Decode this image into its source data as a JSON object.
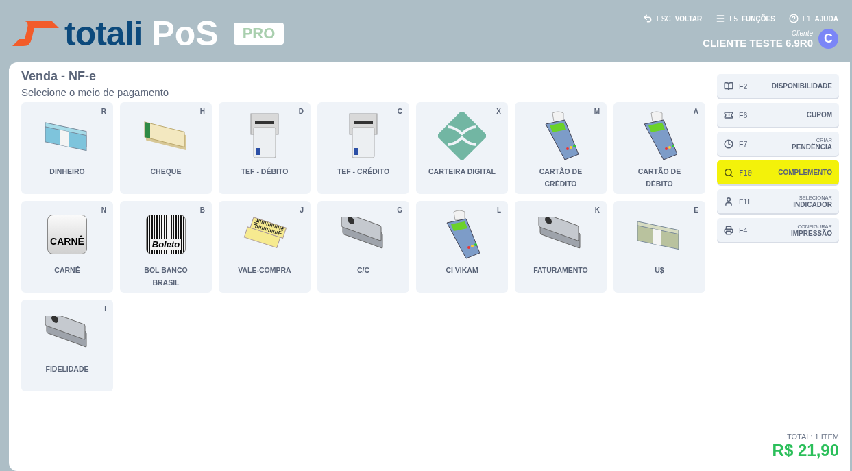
{
  "header": {
    "logo": {
      "word_1": "totali",
      "word_2": "PoS",
      "badge": "PRO"
    },
    "nav": [
      {
        "kind": "back",
        "key": "ESC",
        "label": "VOLTAR"
      },
      {
        "kind": "menu",
        "key": "F5",
        "label": "FUNÇÕES"
      },
      {
        "kind": "help",
        "key": "F1",
        "label": "AJUDA"
      }
    ],
    "client": {
      "caption": "Cliente",
      "name": "CLIENTE TESTE 6.9R0",
      "avatar": "C"
    }
  },
  "title": "Venda - NF-e",
  "subtitle": "Selecione o meio de pagamento",
  "payments": [
    {
      "label": "DINHEIRO",
      "key": "R",
      "kind": "cash"
    },
    {
      "label": "CHEQUE",
      "key": "H",
      "kind": "cheque"
    },
    {
      "label": "TEF - DÉBITO",
      "key": "D",
      "kind": "atm"
    },
    {
      "label": "TEF - CRÉDITO",
      "key": "C",
      "kind": "atm"
    },
    {
      "label": "CARTEIRA DIGITAL",
      "key": "X",
      "kind": "diamond"
    },
    {
      "label": "CARTÃO DE CRÉDITO",
      "key": "M",
      "kind": "terminal"
    },
    {
      "label": "CARTÃO DE DÉBITO",
      "key": "A",
      "kind": "terminal"
    },
    {
      "label": "CARNÊ",
      "key": "N",
      "kind": "carne",
      "icon_text": "CARNÊ"
    },
    {
      "label": "BOL BANCO BRASIL",
      "key": "B",
      "kind": "boleto",
      "icon_text": "Boleto"
    },
    {
      "label": "VALE-COMPRA",
      "key": "J",
      "kind": "voucher"
    },
    {
      "label": "C/C",
      "key": "G",
      "kind": "idcards"
    },
    {
      "label": "CI VIKAM",
      "key": "L",
      "kind": "terminal"
    },
    {
      "label": "FATURAMENTO",
      "key": "K",
      "kind": "idcards"
    },
    {
      "label": "U$",
      "key": "E",
      "kind": "dollars"
    },
    {
      "label": "FIDELIDADE",
      "key": "I",
      "kind": "idcards"
    }
  ],
  "actions": [
    {
      "kind": "book",
      "key": "F2",
      "label": "DISPONIBILIDADE",
      "selected": false
    },
    {
      "kind": "ticket",
      "key": "F6",
      "label": "CUPOM",
      "selected": false
    },
    {
      "kind": "clock",
      "key": "F7",
      "caption": "CRIAR",
      "label": "PENDÊNCIA",
      "selected": false
    },
    {
      "kind": "search",
      "key": "F10",
      "label": "COMPLEMENTO",
      "selected": true
    },
    {
      "kind": "person",
      "key": "F11",
      "caption": "SELECIONAR",
      "label": "INDICADOR",
      "selected": false
    },
    {
      "kind": "printer",
      "key": "F4",
      "caption": "CONFIGURAR",
      "label": "IMPRESSÃO",
      "selected": false
    }
  ],
  "total": {
    "caption": "TOTAL: 1 ITEM",
    "value": "R$ 21,90"
  }
}
